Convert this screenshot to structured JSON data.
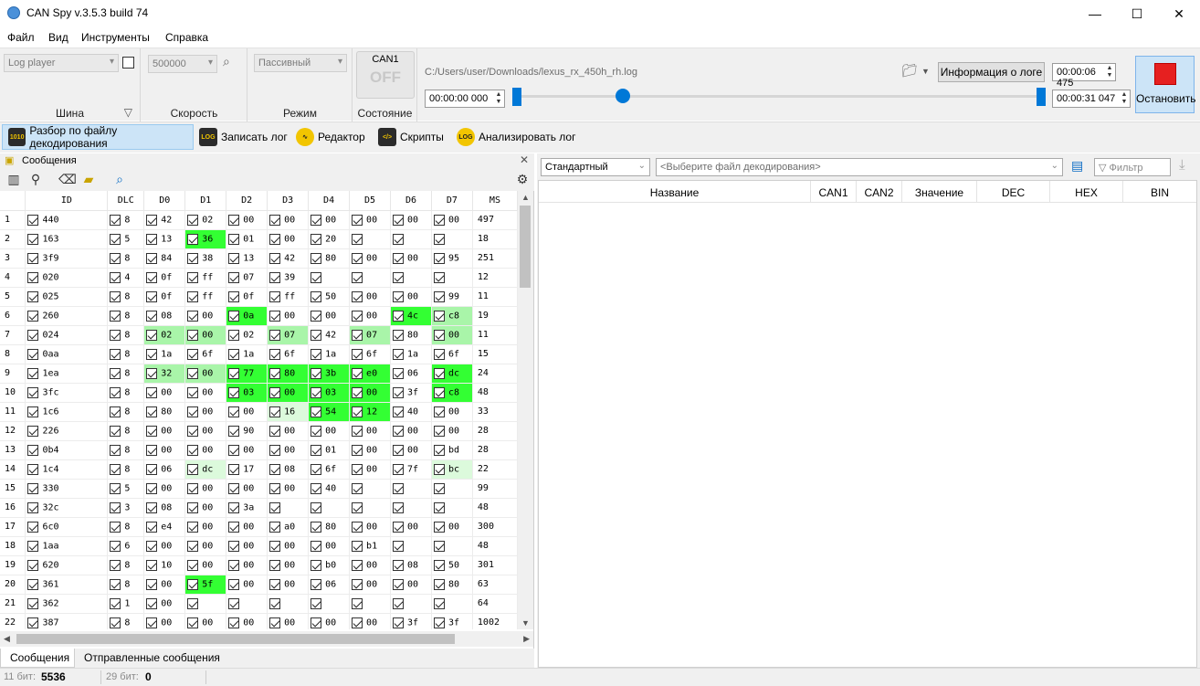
{
  "window": {
    "title": "CAN Spy v.3.5.3 build 74",
    "minimize": "—",
    "maximize": "☐",
    "close": "✕"
  },
  "menu": [
    "Файл",
    "Вид",
    "Инструменты",
    "Справка"
  ],
  "toolbar": {
    "bus_combo": "Log player",
    "bus_label": "Шина",
    "speed_combo": "500000",
    "speed_label": "Скорость",
    "mode_combo": "Пассивный",
    "mode_label": "Режим",
    "state_channel": "CAN1",
    "state_value": "OFF",
    "state_label": "Состояние",
    "file_path": "C:/Users/user/Downloads/lexus_rx_450h_rh.log",
    "log_info_button": "Информация о логе",
    "time_start": "00:00:00 000",
    "time_current": "00:00:06 475",
    "time_end": "00:00:31 047",
    "stop_button": "Остановить",
    "slider_position_fraction": 0.2
  },
  "tabs": [
    {
      "label": "Разбор по файлу декодирования",
      "icon": "decode-icon",
      "active": true
    },
    {
      "label": "Записать лог",
      "icon": "log-icon",
      "active": false
    },
    {
      "label": "Редактор",
      "icon": "editor-icon",
      "active": false
    },
    {
      "label": "Скрипты",
      "icon": "scripts-icon",
      "active": false
    },
    {
      "label": "Анализировать лог",
      "icon": "analyze-log-icon",
      "active": false
    }
  ],
  "messages_panel": {
    "title": "Сообщения",
    "columns": [
      "",
      "ID",
      "DLC",
      "D0",
      "D1",
      "D2",
      "D3",
      "D4",
      "D5",
      "D6",
      "D7",
      "MS"
    ],
    "rows": [
      {
        "n": "1",
        "id": "440",
        "dlc": "8",
        "d": [
          "42",
          "02",
          "00",
          "00",
          "00",
          "00",
          "00",
          "00"
        ],
        "ms": "497",
        "hl": [
          "",
          "",
          "",
          "",
          "",
          "",
          "",
          ""
        ]
      },
      {
        "n": "2",
        "id": "163",
        "dlc": "5",
        "d": [
          "13",
          "36",
          "01",
          "00",
          "20",
          "",
          "",
          ""
        ],
        "ms": "18",
        "hl": [
          "",
          "g1",
          "",
          "",
          "",
          "",
          "",
          ""
        ]
      },
      {
        "n": "3",
        "id": "3f9",
        "dlc": "8",
        "d": [
          "84",
          "38",
          "13",
          "42",
          "80",
          "00",
          "00",
          "95"
        ],
        "ms": "251",
        "hl": [
          "",
          "",
          "",
          "",
          "",
          "",
          "",
          ""
        ]
      },
      {
        "n": "4",
        "id": "020",
        "dlc": "4",
        "d": [
          "0f",
          "ff",
          "07",
          "39",
          "",
          "",
          "",
          ""
        ],
        "ms": "12",
        "hl": [
          "",
          "",
          "",
          "",
          "",
          "",
          "",
          ""
        ]
      },
      {
        "n": "5",
        "id": "025",
        "dlc": "8",
        "d": [
          "0f",
          "ff",
          "0f",
          "ff",
          "50",
          "00",
          "00",
          "99"
        ],
        "ms": "11",
        "hl": [
          "",
          "",
          "",
          "",
          "",
          "",
          "",
          ""
        ]
      },
      {
        "n": "6",
        "id": "260",
        "dlc": "8",
        "d": [
          "08",
          "00",
          "0a",
          "00",
          "00",
          "00",
          "4c",
          "c8"
        ],
        "ms": "19",
        "hl": [
          "",
          "",
          "g1",
          "",
          "",
          "",
          "g1",
          "g2"
        ]
      },
      {
        "n": "7",
        "id": "024",
        "dlc": "8",
        "d": [
          "02",
          "00",
          "02",
          "07",
          "42",
          "07",
          "80",
          "00"
        ],
        "ms": "11",
        "hl": [
          "g2",
          "g2",
          "",
          "g2",
          "",
          "g2",
          "",
          "g2"
        ]
      },
      {
        "n": "8",
        "id": "0aa",
        "dlc": "8",
        "d": [
          "1a",
          "6f",
          "1a",
          "6f",
          "1a",
          "6f",
          "1a",
          "6f"
        ],
        "ms": "15",
        "hl": [
          "",
          "",
          "",
          "",
          "",
          "",
          "",
          ""
        ]
      },
      {
        "n": "9",
        "id": "1ea",
        "dlc": "8",
        "d": [
          "32",
          "00",
          "77",
          "80",
          "3b",
          "e0",
          "06",
          "dc"
        ],
        "ms": "24",
        "hl": [
          "g2",
          "g2",
          "g1",
          "g1",
          "g1",
          "g1",
          "",
          "g1"
        ]
      },
      {
        "n": "10",
        "id": "3fc",
        "dlc": "8",
        "d": [
          "00",
          "00",
          "03",
          "00",
          "03",
          "00",
          "3f",
          "c8"
        ],
        "ms": "48",
        "hl": [
          "",
          "",
          "g1",
          "g1",
          "g1",
          "g1",
          "",
          "g1"
        ]
      },
      {
        "n": "11",
        "id": "1c6",
        "dlc": "8",
        "d": [
          "80",
          "00",
          "00",
          "16",
          "54",
          "12",
          "40",
          "00"
        ],
        "ms": "33",
        "hl": [
          "",
          "",
          "",
          "g3",
          "g1",
          "g1",
          "",
          ""
        ]
      },
      {
        "n": "12",
        "id": "226",
        "dlc": "8",
        "d": [
          "00",
          "00",
          "90",
          "00",
          "00",
          "00",
          "00",
          "00"
        ],
        "ms": "28",
        "hl": [
          "",
          "",
          "",
          "",
          "",
          "",
          "",
          ""
        ]
      },
      {
        "n": "13",
        "id": "0b4",
        "dlc": "8",
        "d": [
          "00",
          "00",
          "00",
          "00",
          "01",
          "00",
          "00",
          "bd"
        ],
        "ms": "28",
        "hl": [
          "",
          "",
          "",
          "",
          "",
          "",
          "",
          ""
        ]
      },
      {
        "n": "14",
        "id": "1c4",
        "dlc": "8",
        "d": [
          "06",
          "dc",
          "17",
          "08",
          "6f",
          "00",
          "7f",
          "bc"
        ],
        "ms": "22",
        "hl": [
          "",
          "g3",
          "",
          "",
          "",
          "",
          "",
          "g3"
        ]
      },
      {
        "n": "15",
        "id": "330",
        "dlc": "5",
        "d": [
          "00",
          "00",
          "00",
          "00",
          "40",
          "",
          "",
          ""
        ],
        "ms": "99",
        "hl": [
          "",
          "",
          "",
          "",
          "",
          "",
          "",
          ""
        ]
      },
      {
        "n": "16",
        "id": "32c",
        "dlc": "3",
        "d": [
          "08",
          "00",
          "3a",
          "",
          "",
          "",
          "",
          ""
        ],
        "ms": "48",
        "hl": [
          "",
          "",
          "",
          "",
          "",
          "",
          "",
          ""
        ]
      },
      {
        "n": "17",
        "id": "6c0",
        "dlc": "8",
        "d": [
          "e4",
          "00",
          "00",
          "a0",
          "80",
          "00",
          "00",
          "00"
        ],
        "ms": "300",
        "hl": [
          "",
          "",
          "",
          "",
          "",
          "",
          "",
          ""
        ]
      },
      {
        "n": "18",
        "id": "1aa",
        "dlc": "6",
        "d": [
          "00",
          "00",
          "00",
          "00",
          "00",
          "b1",
          "",
          ""
        ],
        "ms": "48",
        "hl": [
          "",
          "",
          "",
          "",
          "",
          "",
          "",
          ""
        ]
      },
      {
        "n": "19",
        "id": "620",
        "dlc": "8",
        "d": [
          "10",
          "00",
          "00",
          "00",
          "b0",
          "00",
          "08",
          "50"
        ],
        "ms": "301",
        "hl": [
          "",
          "",
          "",
          "",
          "",
          "",
          "",
          ""
        ]
      },
      {
        "n": "20",
        "id": "361",
        "dlc": "8",
        "d": [
          "00",
          "5f",
          "00",
          "00",
          "06",
          "00",
          "00",
          "80"
        ],
        "ms": "63",
        "hl": [
          "",
          "g1",
          "",
          "",
          "",
          "",
          "",
          ""
        ]
      },
      {
        "n": "21",
        "id": "362",
        "dlc": "1",
        "d": [
          "00",
          "",
          "",
          "",
          "",
          "",
          "",
          ""
        ],
        "ms": "64",
        "hl": [
          "",
          "",
          "",
          "",
          "",
          "",
          "",
          ""
        ]
      },
      {
        "n": "22",
        "id": "387",
        "dlc": "8",
        "d": [
          "00",
          "00",
          "00",
          "00",
          "00",
          "00",
          "3f",
          "3f"
        ],
        "ms": "1002",
        "hl": [
          "",
          "",
          "",
          "",
          "",
          "",
          "",
          ""
        ]
      }
    ]
  },
  "bottom_tabs": [
    "Сообщения",
    "Отправленные сообщения"
  ],
  "status": {
    "bit11_label": "11 бит:",
    "bit11_value": "5536",
    "bit29_label": "29 бит:",
    "bit29_value": "0"
  },
  "decode_panel": {
    "type_combo": "Стандартный",
    "file_placeholder": "<Выберите файл декодирования>",
    "filter_label": "Фильтр",
    "columns": [
      "Название",
      "CAN1",
      "CAN2",
      "Значение",
      "DEC",
      "HEX",
      "BIN"
    ]
  },
  "colors": {
    "highlight_strong": "#33ff33",
    "highlight_medium": "#a9f5a9",
    "highlight_light": "#dcfadc",
    "accent": "#0078d7",
    "stop_red": "#e62020"
  }
}
